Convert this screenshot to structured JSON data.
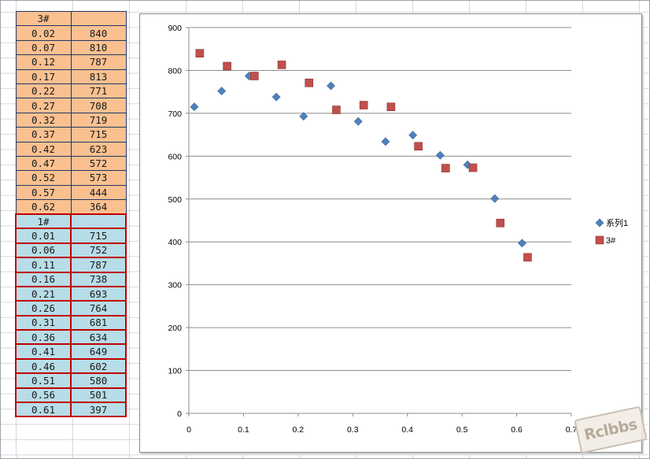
{
  "table_3": {
    "header": [
      "3#",
      ""
    ],
    "rows": [
      [
        "0.02",
        "840"
      ],
      [
        "0.07",
        "810"
      ],
      [
        "0.12",
        "787"
      ],
      [
        "0.17",
        "813"
      ],
      [
        "0.22",
        "771"
      ],
      [
        "0.27",
        "708"
      ],
      [
        "0.32",
        "719"
      ],
      [
        "0.37",
        "715"
      ],
      [
        "0.42",
        "623"
      ],
      [
        "0.47",
        "572"
      ],
      [
        "0.52",
        "573"
      ],
      [
        "0.57",
        "444"
      ],
      [
        "0.62",
        "364"
      ]
    ]
  },
  "table_1": {
    "header": [
      "1#",
      ""
    ],
    "rows": [
      [
        "0.01",
        "715"
      ],
      [
        "0.06",
        "752"
      ],
      [
        "0.11",
        "787"
      ],
      [
        "0.16",
        "738"
      ],
      [
        "0.21",
        "693"
      ],
      [
        "0.26",
        "764"
      ],
      [
        "0.31",
        "681"
      ],
      [
        "0.36",
        "634"
      ],
      [
        "0.41",
        "649"
      ],
      [
        "0.46",
        "602"
      ],
      [
        "0.51",
        "580"
      ],
      [
        "0.56",
        "501"
      ],
      [
        "0.61",
        "397"
      ]
    ]
  },
  "chart_data": {
    "type": "scatter",
    "title": "",
    "xlabel": "",
    "ylabel": "",
    "xlim": [
      0,
      0.7
    ],
    "ylim": [
      0,
      900
    ],
    "x_ticks": [
      "0",
      "0.1",
      "0.2",
      "0.3",
      "0.4",
      "0.5",
      "0.6",
      "0.7"
    ],
    "y_ticks": [
      "0",
      "100",
      "200",
      "300",
      "400",
      "500",
      "600",
      "700",
      "800",
      "900"
    ],
    "grid": "horizontal",
    "legend_position": "right",
    "series": [
      {
        "name": "系列1",
        "marker": "diamond",
        "color": "#4f81bd",
        "x": [
          0.01,
          0.06,
          0.11,
          0.16,
          0.21,
          0.26,
          0.31,
          0.36,
          0.41,
          0.46,
          0.51,
          0.56,
          0.61
        ],
        "y": [
          715,
          752,
          787,
          738,
          693,
          764,
          681,
          634,
          649,
          602,
          580,
          501,
          397
        ]
      },
      {
        "name": "3#",
        "marker": "square",
        "color": "#c0504d",
        "x": [
          0.02,
          0.07,
          0.12,
          0.17,
          0.22,
          0.27,
          0.32,
          0.37,
          0.42,
          0.47,
          0.52,
          0.57,
          0.62
        ],
        "y": [
          840,
          810,
          787,
          813,
          771,
          708,
          719,
          715,
          623,
          572,
          573,
          444,
          364
        ]
      }
    ]
  },
  "watermark": "Rclbbs"
}
